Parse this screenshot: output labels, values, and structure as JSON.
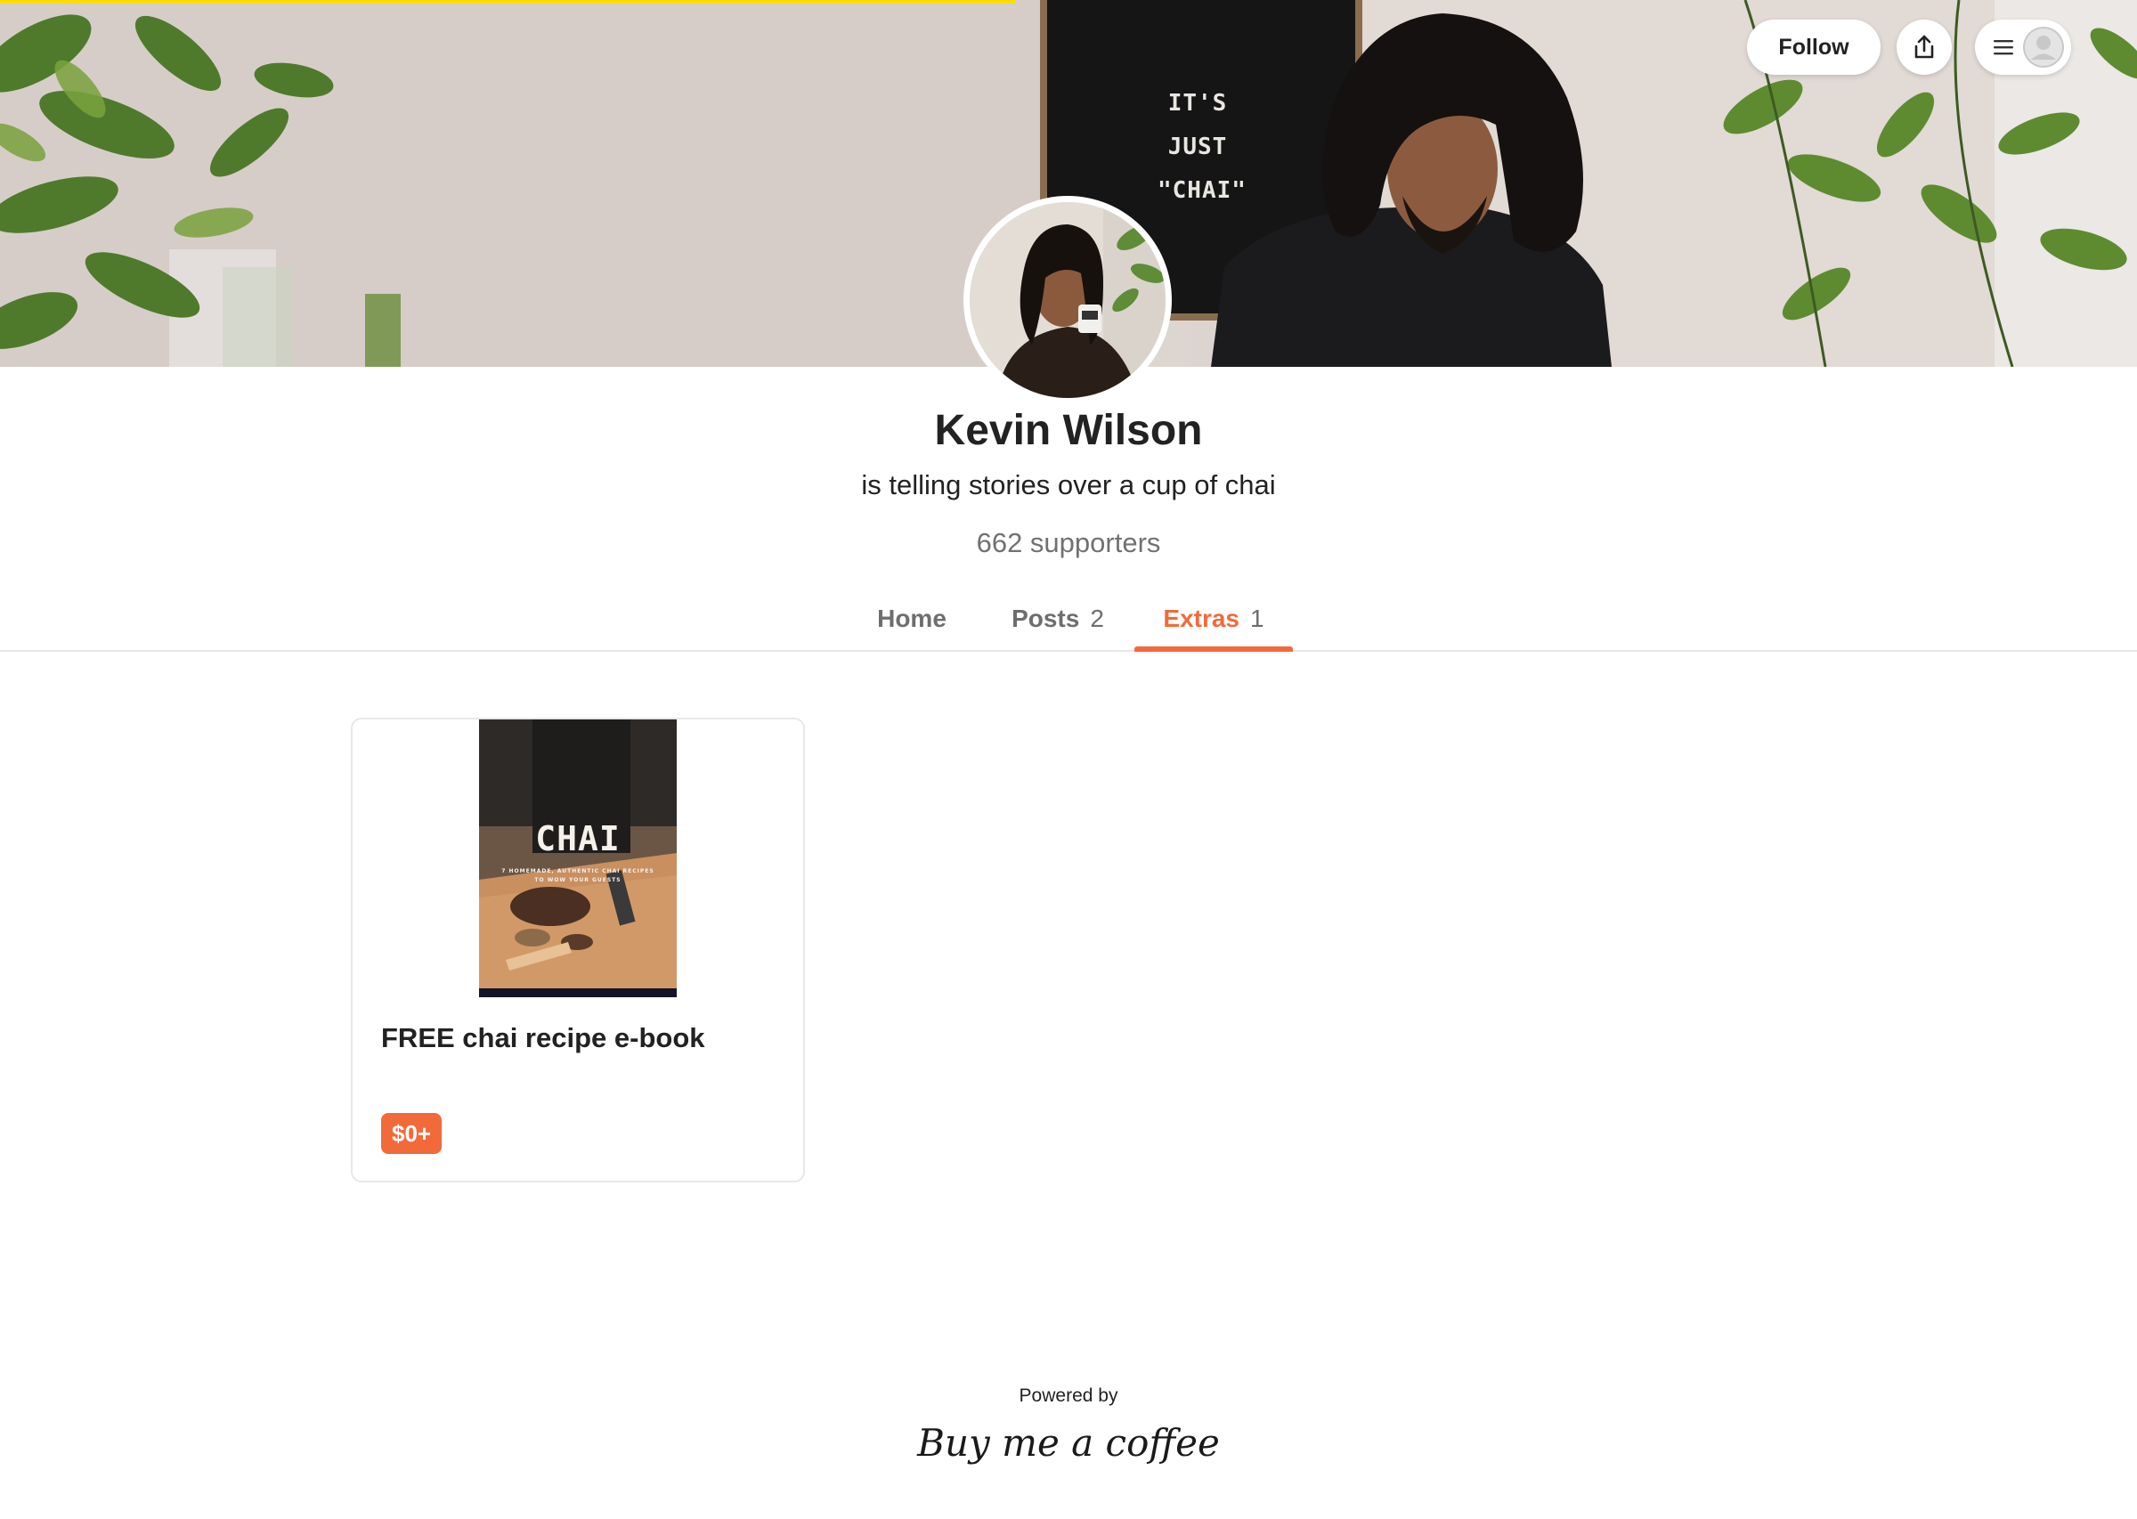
{
  "page_progress": 0.475,
  "cover": {
    "letterboard_lines": [
      "IT'S",
      "JUST",
      "\"CHAI\""
    ]
  },
  "header": {
    "follow_label": "Follow",
    "share_icon": "share-upload-icon",
    "menu_icon": "hamburger-menu-icon",
    "user_icon": "user-avatar-icon"
  },
  "profile": {
    "name": "Kevin Wilson",
    "tagline": "is telling stories over a cup of chai",
    "supporters": "662 supporters"
  },
  "tabs": [
    {
      "label": "Home",
      "count": "",
      "active": false
    },
    {
      "label": "Posts",
      "count": "2",
      "active": false
    },
    {
      "label": "Extras",
      "count": "1",
      "active": true
    }
  ],
  "extras": [
    {
      "cover_title": "CHAI",
      "cover_subtitle": "7 HOMEMADE, AUTHENTIC CHAI RECIPES TO WOW YOUR GUESTS",
      "title": "FREE chai recipe e-book",
      "price": "$0+"
    }
  ],
  "footer": {
    "powered_by": "Powered by",
    "brand": "Buy me a coffee"
  },
  "colors": {
    "accent": "#f26a3a",
    "progress": "#ffdd00",
    "muted_text": "#717171"
  }
}
